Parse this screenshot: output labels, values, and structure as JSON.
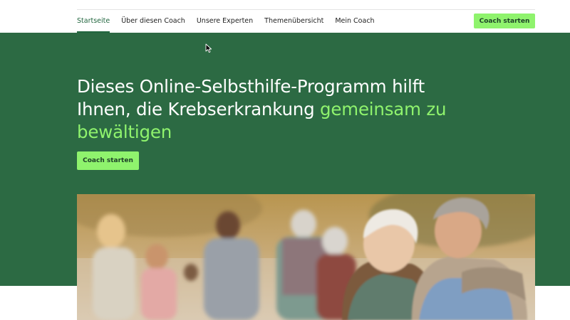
{
  "nav": {
    "items": [
      {
        "label": "Startseite",
        "active": true
      },
      {
        "label": "Über diesen Coach",
        "active": false
      },
      {
        "label": "Unsere Experten",
        "active": false
      },
      {
        "label": "Themenübersicht",
        "active": false
      },
      {
        "label": "Mein Coach",
        "active": false
      }
    ],
    "cta_label": "Coach starten"
  },
  "hero": {
    "title_part1": "Dieses Online-Selbsthilfe-Programm hilft Ihnen, die Krebserkrankung ",
    "title_highlight": "gemeinsam zu bewältigen",
    "cta_label": "Coach starten"
  },
  "colors": {
    "brand_green": "#2c6a43",
    "accent_green": "#8ff36d",
    "nav_active": "#22663f"
  },
  "image": {
    "icon": "photo-group-seniors"
  }
}
